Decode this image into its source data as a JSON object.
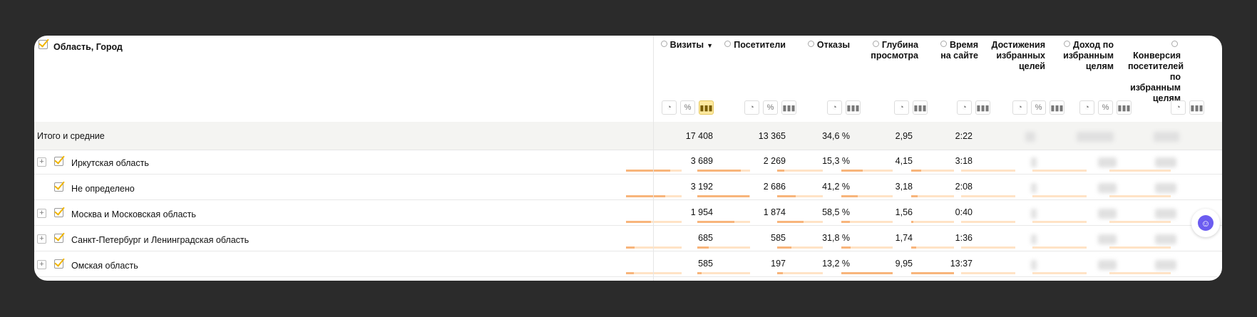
{
  "table": {
    "dimension_label": "Область, Город",
    "columns": [
      {
        "label": "Визиты",
        "sorted": true
      },
      {
        "label": "Посетители"
      },
      {
        "label": "Отказы"
      },
      {
        "label": "Глубина просмотра"
      },
      {
        "label": "Время на сайте"
      },
      {
        "label": "Достижения избранных целей"
      },
      {
        "label": "Доход по избранным целям"
      },
      {
        "label": "Конверсия посетителей по избранным целям"
      }
    ],
    "sort_icon": "▼",
    "view_icons": {
      "pie": "◔",
      "percent": "%",
      "bars": "▮▮▮"
    },
    "totals": {
      "label": "Итого и средние",
      "visits": "17 408",
      "visitors": "13 365",
      "bounces": "34,6 %",
      "depth": "2,95",
      "time": "2:22"
    },
    "rows": [
      {
        "name": "Иркутская область",
        "expandable": true,
        "visits": "3 689",
        "visitors": "2 269",
        "bounces": "15,3 %",
        "depth": "4,15",
        "time": "3:18",
        "visits_share": 0.8,
        "visitors_share": 0.82,
        "bounces_share": 0.15,
        "depth_share": 0.42,
        "time_share": 0.24
      },
      {
        "name": "Не определено",
        "expandable": false,
        "visits": "3 192",
        "visitors": "2 686",
        "bounces": "41,2 %",
        "depth": "3,18",
        "time": "2:08",
        "visits_share": 0.7,
        "visitors_share": 0.98,
        "bounces_share": 0.41,
        "depth_share": 0.32,
        "time_share": 0.15
      },
      {
        "name": "Москва и Московская область",
        "expandable": true,
        "visits": "1 954",
        "visitors": "1 874",
        "bounces": "58,5 %",
        "depth": "1,56",
        "time": "0:40",
        "visits_share": 0.45,
        "visitors_share": 0.7,
        "bounces_share": 0.58,
        "depth_share": 0.16,
        "time_share": 0.05
      },
      {
        "name": "Санкт-Петербург и Ленинградская область",
        "expandable": true,
        "visits": "685",
        "visitors": "585",
        "bounces": "31,8 %",
        "depth": "1,74",
        "time": "1:36",
        "visits_share": 0.16,
        "visitors_share": 0.22,
        "bounces_share": 0.32,
        "depth_share": 0.18,
        "time_share": 0.12
      },
      {
        "name": "Омская область",
        "expandable": true,
        "visits": "585",
        "visitors": "197",
        "bounces": "13,2 %",
        "depth": "9,95",
        "time": "13:37",
        "visits_share": 0.14,
        "visitors_share": 0.08,
        "bounces_share": 0.13,
        "depth_share": 1.0,
        "time_share": 1.0
      }
    ]
  },
  "floating_button_icon": "assistant-icon"
}
